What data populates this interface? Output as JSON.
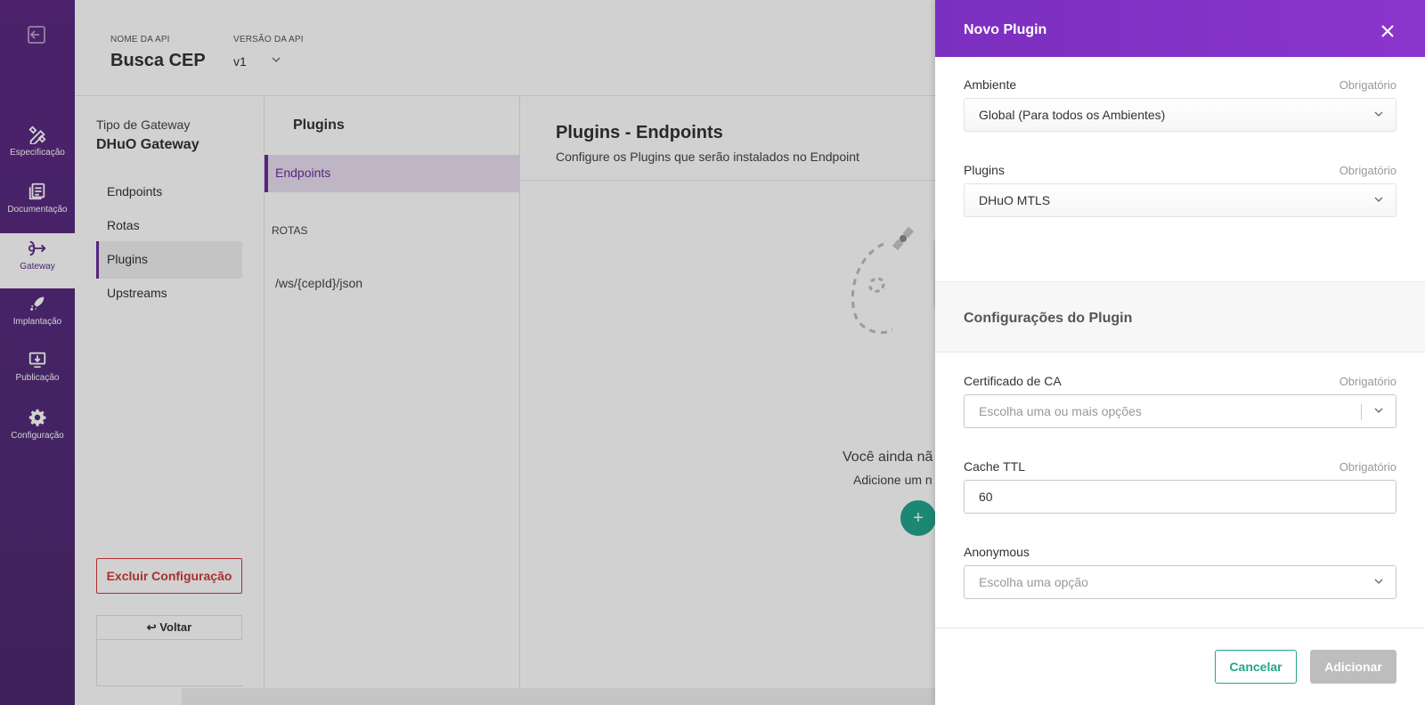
{
  "sidebar": {
    "exit_icon": "exit-icon",
    "items": [
      {
        "label": "Especificação",
        "icon": "pencil-ruler-icon",
        "active": false
      },
      {
        "label": "Documentação",
        "icon": "document-icon",
        "active": false
      },
      {
        "label": "Gateway",
        "icon": "gateway-icon",
        "active": true
      },
      {
        "label": "Implantação",
        "icon": "rocket-icon",
        "active": false
      },
      {
        "label": "Publicação",
        "icon": "publish-icon",
        "active": false
      },
      {
        "label": "Configuração",
        "icon": "gear-icon",
        "active": false
      }
    ]
  },
  "header": {
    "api_name_label": "NOME DA API",
    "api_name": "Busca CEP",
    "api_version_label": "VERSÃO DA API",
    "api_version": "v1"
  },
  "gateway_menu": {
    "type_label": "Tipo de Gateway",
    "type_value": "DHuO Gateway",
    "items": [
      "Endpoints",
      "Rotas",
      "Plugins",
      "Upstreams"
    ],
    "active_item": "Plugins",
    "delete_label": "Excluir Configuração",
    "back_label": "↩   Voltar"
  },
  "plugins_menu": {
    "title": "Plugins",
    "active_item": "Endpoints",
    "section_label": "ROTAS",
    "route": "/ws/{cepId}/json"
  },
  "main": {
    "title": "Plugins - Endpoints",
    "subtitle": "Configure os Plugins que serão instalados no Endpoint",
    "empty_title": "Você ainda nã",
    "empty_sub": "Adicione um n",
    "fab_label": "+"
  },
  "drawer": {
    "title": "Novo Plugin",
    "required_label": "Obrigatório",
    "ambiente_label": "Ambiente",
    "ambiente_value": "Global (Para todos os Ambientes)",
    "plugins_label": "Plugins",
    "plugins_value": "DHuO MTLS",
    "section_title": "Configurações do Plugin",
    "ca_label": "Certificado de CA",
    "ca_placeholder": "Escolha uma ou mais opções",
    "cache_label": "Cache TTL",
    "cache_value": "60",
    "anon_label": "Anonymous",
    "anon_placeholder": "Escolha uma opção",
    "cancel_label": "Cancelar",
    "add_label": "Adicionar"
  },
  "colors": {
    "brand_purple": "#5c2a83",
    "header_purple": "#7b2fc0",
    "accent_teal": "#23a58c",
    "danger_red": "#d03a3a"
  }
}
